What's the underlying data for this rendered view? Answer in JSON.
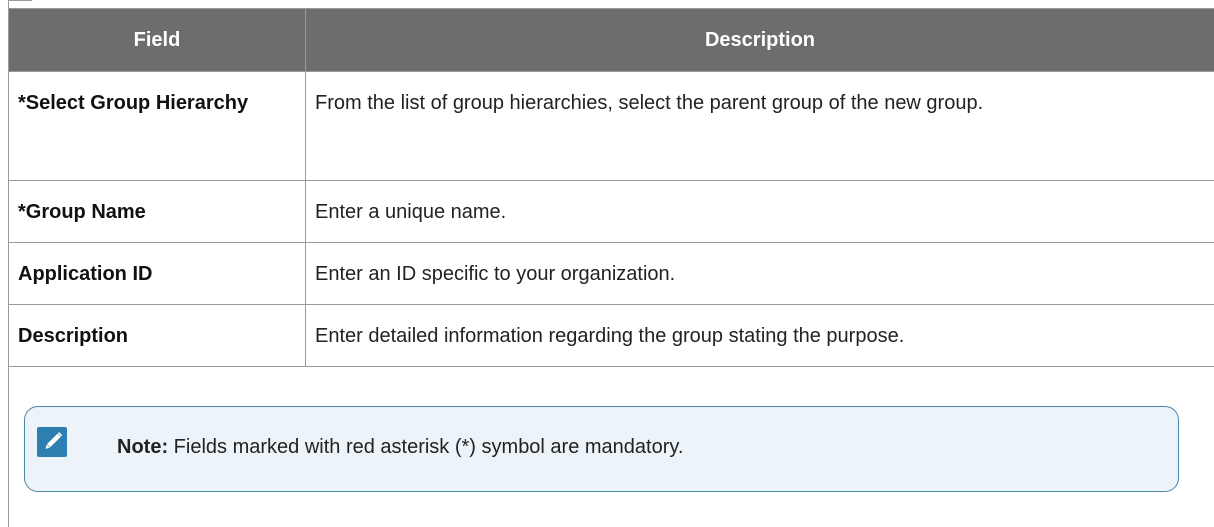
{
  "table": {
    "headers": {
      "field": "Field",
      "description": "Description"
    },
    "rows": [
      {
        "field": "*Select Group Hierarchy",
        "description": "From the list of group hierarchies, select the parent group of the new group."
      },
      {
        "field": "*Group Name",
        "description": "Enter a unique name."
      },
      {
        "field": "Application ID",
        "description": "Enter an ID specific to your organization."
      },
      {
        "field": "Description",
        "description": "Enter detailed information regarding the group stating the purpose."
      }
    ]
  },
  "note": {
    "icon": "edit-note-icon",
    "label": "Note:",
    "text": " Fields marked with red asterisk (*) symbol are mandatory."
  },
  "colors": {
    "header_bg": "#6d6d6d",
    "note_border": "#4a86a8",
    "note_icon": "#2d7fb0"
  }
}
